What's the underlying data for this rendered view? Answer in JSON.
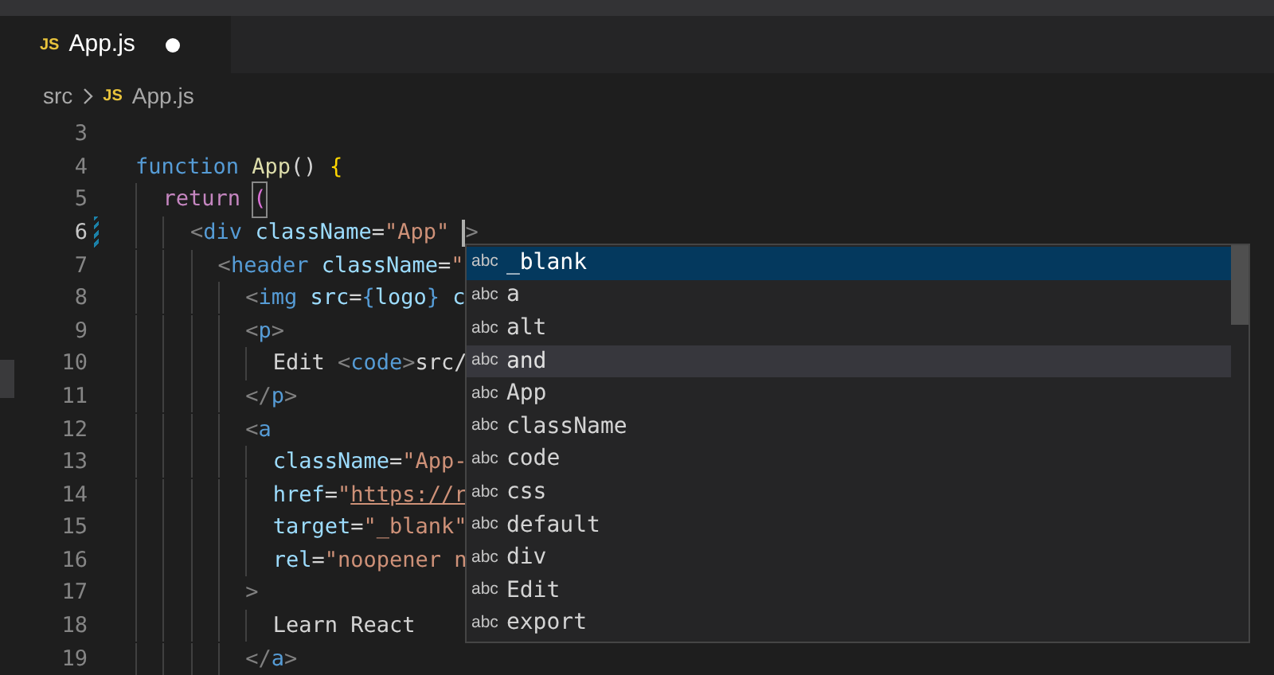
{
  "tabs": [
    {
      "icon_text": "JS",
      "label": "App.js",
      "modified": true,
      "selected": true
    }
  ],
  "breadcrumb": [
    {
      "label": "src"
    },
    {
      "icon_text": "JS",
      "label": "App.js"
    }
  ],
  "editor": {
    "lines": [
      {
        "number": "3",
        "current": false,
        "modified": false
      },
      {
        "number": "4",
        "current": false,
        "modified": false,
        "tokens": [
          {
            "text": "function ",
            "kind": "keyword"
          },
          {
            "text": "App",
            "kind": "function"
          },
          {
            "text": "() ",
            "kind": "text"
          },
          {
            "text": "{",
            "kind": "brace"
          }
        ]
      },
      {
        "number": "5",
        "current": false,
        "modified": false,
        "tokens": [
          {
            "text": "  return ",
            "kind": "control"
          },
          {
            "text": "(",
            "kind": "bracket-match"
          }
        ]
      },
      {
        "number": "6",
        "current": true,
        "modified": true,
        "tokens": [
          {
            "text": "    <",
            "kind": "punct"
          },
          {
            "text": "div ",
            "kind": "tag"
          },
          {
            "text": "className",
            "kind": "attr"
          },
          {
            "text": "=",
            "kind": "text"
          },
          {
            "text": "\"App\" ",
            "kind": "string"
          },
          {
            "kind": "cursor"
          },
          {
            "text": ">",
            "kind": "punct"
          }
        ]
      },
      {
        "number": "7",
        "current": false,
        "modified": false,
        "tokens": [
          {
            "text": "      <",
            "kind": "punct"
          },
          {
            "text": "header ",
            "kind": "tag"
          },
          {
            "text": "className",
            "kind": "attr"
          },
          {
            "text": "=",
            "kind": "text"
          },
          {
            "text": "\"",
            "kind": "string"
          }
        ]
      },
      {
        "number": "8",
        "current": false,
        "modified": false,
        "tokens": [
          {
            "text": "        <",
            "kind": "punct"
          },
          {
            "text": "img ",
            "kind": "tag"
          },
          {
            "text": "src",
            "kind": "attr"
          },
          {
            "text": "=",
            "kind": "text"
          },
          {
            "text": "{",
            "kind": "tag"
          },
          {
            "text": "logo",
            "kind": "attr"
          },
          {
            "text": "} ",
            "kind": "tag"
          },
          {
            "text": "c",
            "kind": "attr"
          }
        ]
      },
      {
        "number": "9",
        "current": false,
        "modified": false,
        "tokens": [
          {
            "text": "        <",
            "kind": "punct"
          },
          {
            "text": "p",
            "kind": "tag"
          },
          {
            "text": ">",
            "kind": "punct"
          }
        ]
      },
      {
        "number": "10",
        "current": false,
        "modified": false,
        "tokens": [
          {
            "text": "          Edit ",
            "kind": "text"
          },
          {
            "text": "<",
            "kind": "punct"
          },
          {
            "text": "code",
            "kind": "tag"
          },
          {
            "text": ">",
            "kind": "punct"
          },
          {
            "text": "src/",
            "kind": "text"
          }
        ]
      },
      {
        "number": "11",
        "current": false,
        "modified": false,
        "tokens": [
          {
            "text": "        </",
            "kind": "punct"
          },
          {
            "text": "p",
            "kind": "tag"
          },
          {
            "text": ">",
            "kind": "punct"
          }
        ]
      },
      {
        "number": "12",
        "current": false,
        "modified": false,
        "tokens": [
          {
            "text": "        <",
            "kind": "punct"
          },
          {
            "text": "a",
            "kind": "tag"
          }
        ]
      },
      {
        "number": "13",
        "current": false,
        "modified": false,
        "tokens": [
          {
            "text": "          className",
            "kind": "attr"
          },
          {
            "text": "=",
            "kind": "text"
          },
          {
            "text": "\"App-",
            "kind": "string"
          }
        ]
      },
      {
        "number": "14",
        "current": false,
        "modified": false,
        "tokens": [
          {
            "text": "          href",
            "kind": "attr"
          },
          {
            "text": "=",
            "kind": "text"
          },
          {
            "text": "\"",
            "kind": "string"
          },
          {
            "text": "https://r",
            "kind": "link"
          }
        ]
      },
      {
        "number": "15",
        "current": false,
        "modified": false,
        "tokens": [
          {
            "text": "          target",
            "kind": "attr"
          },
          {
            "text": "=",
            "kind": "text"
          },
          {
            "text": "\"_blank\"",
            "kind": "string"
          }
        ]
      },
      {
        "number": "16",
        "current": false,
        "modified": false,
        "tokens": [
          {
            "text": "          rel",
            "kind": "attr"
          },
          {
            "text": "=",
            "kind": "text"
          },
          {
            "text": "\"noopener n",
            "kind": "string"
          }
        ]
      },
      {
        "number": "17",
        "current": false,
        "modified": false,
        "tokens": [
          {
            "text": "        >",
            "kind": "punct"
          }
        ]
      },
      {
        "number": "18",
        "current": false,
        "modified": false,
        "tokens": [
          {
            "text": "          Learn React",
            "kind": "text"
          }
        ]
      },
      {
        "number": "19",
        "current": false,
        "modified": false,
        "tokens": [
          {
            "text": "        </",
            "kind": "punct"
          },
          {
            "text": "a",
            "kind": "tag"
          },
          {
            "text": ">",
            "kind": "punct"
          }
        ]
      }
    ]
  },
  "suggestions": [
    {
      "icon_text": "abc",
      "label": "_blank",
      "selected": true,
      "hovered": false
    },
    {
      "icon_text": "abc",
      "label": "a",
      "selected": false,
      "hovered": false
    },
    {
      "icon_text": "abc",
      "label": "alt",
      "selected": false,
      "hovered": false
    },
    {
      "icon_text": "abc",
      "label": "and",
      "selected": false,
      "hovered": true
    },
    {
      "icon_text": "abc",
      "label": "App",
      "selected": false,
      "hovered": false
    },
    {
      "icon_text": "abc",
      "label": "className",
      "selected": false,
      "hovered": false
    },
    {
      "icon_text": "abc",
      "label": "code",
      "selected": false,
      "hovered": false
    },
    {
      "icon_text": "abc",
      "label": "css",
      "selected": false,
      "hovered": false
    },
    {
      "icon_text": "abc",
      "label": "default",
      "selected": false,
      "hovered": false
    },
    {
      "icon_text": "abc",
      "label": "div",
      "selected": false,
      "hovered": false
    },
    {
      "icon_text": "abc",
      "label": "Edit",
      "selected": false,
      "hovered": false
    },
    {
      "icon_text": "abc",
      "label": "export",
      "selected": false,
      "hovered": false
    }
  ]
}
